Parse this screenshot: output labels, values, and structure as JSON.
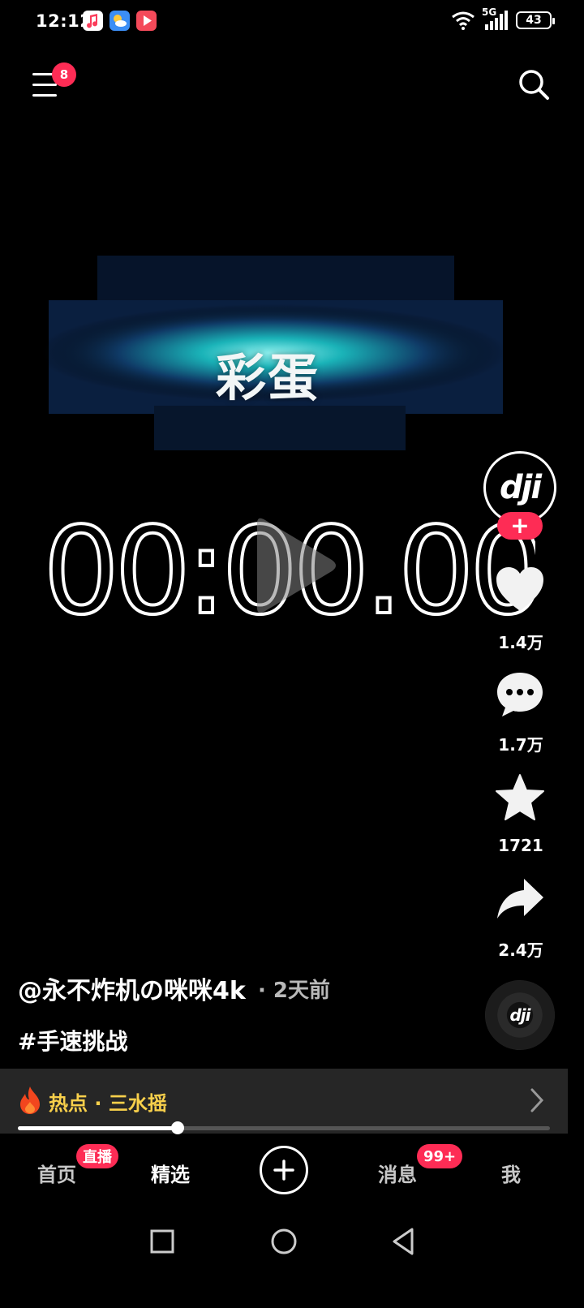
{
  "status_bar": {
    "time": "12:12",
    "network": "5G",
    "battery": "43",
    "notification_icons": [
      "music-app-icon",
      "weather-app-icon",
      "video-app-icon"
    ]
  },
  "top_bar": {
    "menu_badge": "8",
    "icons": [
      "menu-icon",
      "search-icon"
    ]
  },
  "video": {
    "title": "彩蛋",
    "timer": "00:00.00",
    "play_icon": "play-icon"
  },
  "right_rail": {
    "avatar_logo": "dji",
    "follow_label": "+",
    "likes": "1.4万",
    "comments": "1.7万",
    "favorites": "1721",
    "shares": "2.4万"
  },
  "caption": {
    "author": "@永不炸机の咪咪4k",
    "time": "· 2天前",
    "hashtag": "#手速挑战"
  },
  "hot": {
    "label": "热点 · 三水摇"
  },
  "progress": {
    "fraction": 0.3
  },
  "bottom_nav": {
    "tabs": [
      {
        "label": "首页"
      },
      {
        "label": "精选"
      },
      {
        "label": "消息"
      },
      {
        "label": "我"
      }
    ],
    "live_badge": "直播",
    "messages_badge": "99+"
  },
  "colors": {
    "accent": "#fe2c55",
    "hot_text": "#f8d04b",
    "background": "#000000"
  }
}
